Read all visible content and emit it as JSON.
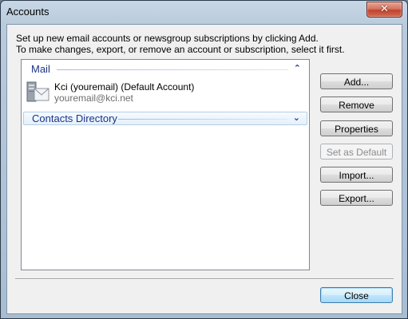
{
  "window": {
    "title": "Accounts",
    "close_glyph": "✕"
  },
  "description": {
    "line1": "Set up new email accounts or newsgroup subscriptions by clicking Add.",
    "line2": "To make changes, export, or remove an account or subscription, select it first."
  },
  "groups": [
    {
      "label": "Mail",
      "chevron": "⌃",
      "expanded": true
    },
    {
      "label": "Contacts Directory",
      "chevron": "⌄",
      "expanded": false
    }
  ],
  "account": {
    "name": "Kci (youremail) (Default Account)",
    "email": "youremail@kci.net",
    "icon": "mail-account-icon"
  },
  "buttons": {
    "add": "Add...",
    "remove": "Remove",
    "properties": "Properties",
    "set_default": "Set as Default",
    "import": "Import...",
    "export": "Export...",
    "close": "Close"
  }
}
